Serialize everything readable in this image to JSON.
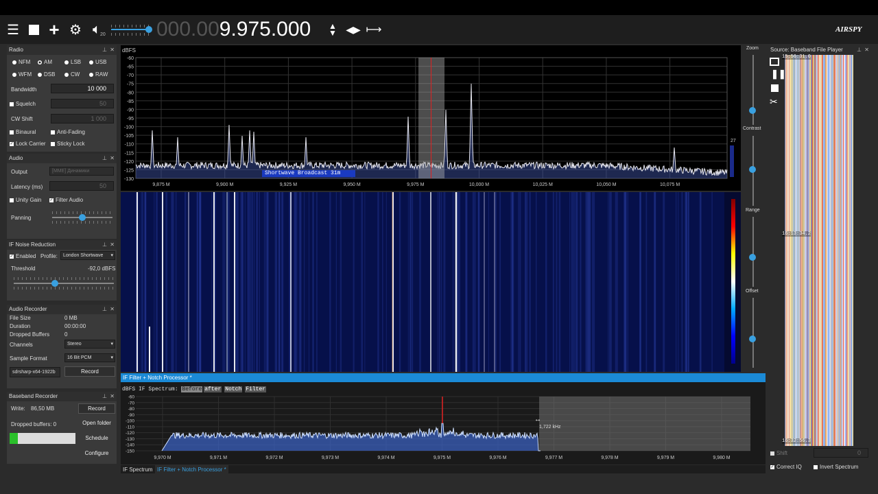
{
  "toolbar": {
    "frequency_dim": "000.00",
    "frequency_lit": "9.975.000",
    "volume": "20",
    "logo": "AIRSPY"
  },
  "radio": {
    "title": "Radio",
    "modes": [
      "NFM",
      "AM",
      "LSB",
      "USB",
      "WFM",
      "DSB",
      "CW",
      "RAW"
    ],
    "selected": "AM",
    "bandwidth_label": "Bandwidth",
    "bandwidth": "10 000",
    "squelch_label": "Squelch",
    "squelch": "50",
    "cwshift_label": "CW Shift",
    "cwshift": "1 000",
    "binaural": "Binaural",
    "antifading": "Anti-Fading",
    "lockcarrier": "Lock Carrier",
    "stickylock": "Sticky Lock"
  },
  "audio": {
    "title": "Audio",
    "output_label": "Output",
    "output": "[MME] Динамики",
    "latency_label": "Latency (ms)",
    "latency": "50",
    "unity_gain": "Unity Gain",
    "filter_audio": "Filter Audio",
    "panning": "Panning"
  },
  "ifnr": {
    "title": "IF Noise Reduction",
    "enabled": "Enabled",
    "profile_label": "Profile:",
    "profile": "London Shortwave",
    "threshold_label": "Threshold",
    "threshold": "-92,0 dBFS"
  },
  "recorder": {
    "title": "Audio Recorder",
    "filesize_label": "File Size",
    "filesize": "0 MB",
    "duration_label": "Duration",
    "duration": "00:00:00",
    "dropped_label": "Dropped Buffers",
    "dropped": "0",
    "channels_label": "Channels",
    "channels": "Stereo",
    "format_label": "Sample Format",
    "format": "16 Bit PCM",
    "file": "sdrsharp-x64-1922b",
    "record": "Record"
  },
  "baseband": {
    "title": "Baseband Recorder",
    "write_label": "Write:",
    "write": "86,50 MB",
    "record": "Record",
    "dropped": "Dropped buffers: 0",
    "open_folder": "Open folder",
    "schedule": "Schedule",
    "configure": "Configure",
    "fill_fraction": 0.12
  },
  "spectrum": {
    "unit": "dBFS",
    "y_ticks": [
      "-60",
      "-65",
      "-70",
      "-75",
      "-80",
      "-85",
      "-90",
      "-95",
      "-100",
      "-105",
      "-110",
      "-115",
      "-120",
      "-125",
      "-130"
    ],
    "x_ticks": [
      "9,875 M",
      "9,900 M",
      "9,925 M",
      "9,950 M",
      "9,975 M",
      "10,000 M",
      "10,025 M",
      "10,050 M",
      "10,075 M"
    ],
    "band_label": "Shortwave Broadcast 31m",
    "level": "27"
  },
  "side_controls": {
    "zoom": "Zoom",
    "contrast": "Contrast",
    "range": "Range",
    "offset": "Offset"
  },
  "if_filter": {
    "title": "IF Filter + Notch Processor *",
    "spectrum_label": "dBFS IF Spectrum:",
    "tabs": [
      "Before",
      "after",
      "Notch",
      "Filter"
    ],
    "y_ticks": [
      "-60",
      "-70",
      "-80",
      "-90",
      "-100",
      "-110",
      "-120",
      "-130",
      "-140",
      "-150"
    ],
    "x_ticks": [
      "9,970 M",
      "9,971 M",
      "9,972 M",
      "9,973 M",
      "9,974 M",
      "9,975 M",
      "9,976 M",
      "9,977 M",
      "9,978 M",
      "9,979 M",
      "9,980 M"
    ],
    "cursor_label": "1,722 kHz"
  },
  "bottom_tabs": [
    "IF Spectrum",
    "IF Filter + Notch Processor *"
  ],
  "source": {
    "title": "Source: Baseband File Player",
    "times": [
      "15:56:31.0",
      "16:13:34.2",
      "16:32:56.3"
    ],
    "shift": "Shift",
    "shift_value": "0",
    "correct_iq": "Correct IQ",
    "invert": "Invert Spectrum"
  }
}
